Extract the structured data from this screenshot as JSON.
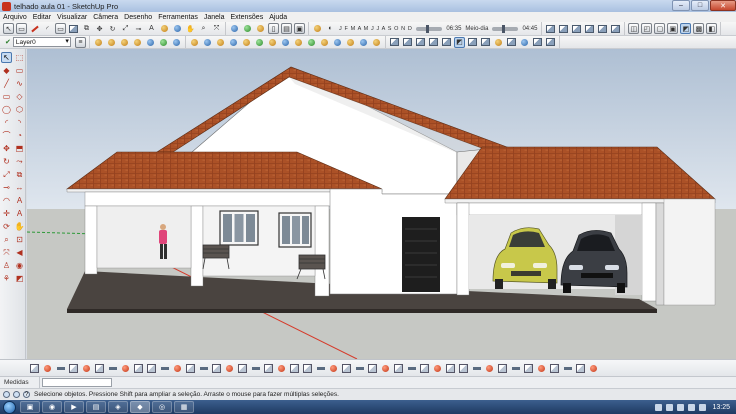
{
  "window": {
    "title": "telhado aula 01 - SketchUp Pro",
    "min_glyph": "–",
    "max_glyph": "□",
    "close_glyph": "✕"
  },
  "menu": [
    "Arquivo",
    "Editar",
    "Visualizar",
    "Câmera",
    "Desenho",
    "Ferramentas",
    "Janela",
    "Extensões",
    "Ajuda"
  ],
  "toolbar": {
    "layer_name": "Layer0",
    "layer_check": "✔",
    "months": "J F M A M J J A S O N D",
    "shadow_time_start": "06:35",
    "shadow_time_mid": "Meio-dia",
    "shadow_time_end": "04:45"
  },
  "left_tools": [
    {
      "name": "select-tool-icon",
      "glyph": "↖",
      "selected": true
    },
    {
      "name": "make-component-icon",
      "glyph": "⬚"
    },
    {
      "name": "paint-bucket-icon",
      "glyph": "◆"
    },
    {
      "name": "eraser-icon",
      "glyph": "▭"
    },
    {
      "name": "line-tool-icon",
      "glyph": "╱"
    },
    {
      "name": "freehand-icon",
      "glyph": "∿"
    },
    {
      "name": "rectangle-icon",
      "glyph": "▭"
    },
    {
      "name": "rotated-rectangle-icon",
      "glyph": "◇"
    },
    {
      "name": "circle-icon",
      "glyph": "◯"
    },
    {
      "name": "polygon-icon",
      "glyph": "⬡"
    },
    {
      "name": "arc-icon",
      "glyph": "◜"
    },
    {
      "name": "two-point-arc-icon",
      "glyph": "◝"
    },
    {
      "name": "three-point-arc-icon",
      "glyph": "⌒"
    },
    {
      "name": "pie-icon",
      "glyph": "◔"
    },
    {
      "name": "move-icon",
      "glyph": "✥"
    },
    {
      "name": "push-pull-icon",
      "glyph": "⬒"
    },
    {
      "name": "rotate-icon",
      "glyph": "↻"
    },
    {
      "name": "follow-me-icon",
      "glyph": "⤳"
    },
    {
      "name": "scale-icon",
      "glyph": "⤢"
    },
    {
      "name": "offset-icon",
      "glyph": "⧉"
    },
    {
      "name": "tape-measure-icon",
      "glyph": "⊸"
    },
    {
      "name": "dimension-icon",
      "glyph": "↔"
    },
    {
      "name": "protractor-icon",
      "glyph": "◠"
    },
    {
      "name": "text-tool-icon",
      "glyph": "A"
    },
    {
      "name": "axes-icon",
      "glyph": "✛"
    },
    {
      "name": "3d-text-icon",
      "glyph": "A"
    },
    {
      "name": "orbit-icon",
      "glyph": "⟳"
    },
    {
      "name": "pan-icon",
      "glyph": "✋"
    },
    {
      "name": "zoom-icon",
      "glyph": "⌕"
    },
    {
      "name": "zoom-window-icon",
      "glyph": "⊡"
    },
    {
      "name": "zoom-extents-icon",
      "glyph": "⤧"
    },
    {
      "name": "previous-view-icon",
      "glyph": "◀"
    },
    {
      "name": "position-camera-icon",
      "glyph": "♙"
    },
    {
      "name": "look-around-icon",
      "glyph": "◉"
    },
    {
      "name": "walk-icon",
      "glyph": "⚘"
    },
    {
      "name": "section-plane-icon",
      "glyph": "◩"
    }
  ],
  "measurements_label": "Medidas",
  "status_text": "Selecione objetos. Pressione Shift para ampliar a seleção. Arraste o mouse para fazer múltiplas seleções.",
  "taskbar": {
    "clock": "13:25",
    "apps": [
      {
        "name": "taskbar-explorer",
        "glyph": "▣"
      },
      {
        "name": "taskbar-browser",
        "glyph": "◉"
      },
      {
        "name": "taskbar-media",
        "glyph": "▶"
      },
      {
        "name": "taskbar-folder",
        "glyph": "▤"
      },
      {
        "name": "taskbar-app-1",
        "glyph": "◈"
      },
      {
        "name": "taskbar-sketchup",
        "glyph": "◆"
      },
      {
        "name": "taskbar-chrome",
        "glyph": "◎"
      },
      {
        "name": "taskbar-app-2",
        "glyph": "▦"
      }
    ]
  },
  "colors": {
    "sky": "#c9d6e4",
    "ground": "#c5c8c3",
    "roof": "#a84c25",
    "wall": "#ffffff",
    "slab": "#4a4440",
    "axis_red": "#d63a2a",
    "axis_green": "#2d9a38"
  }
}
